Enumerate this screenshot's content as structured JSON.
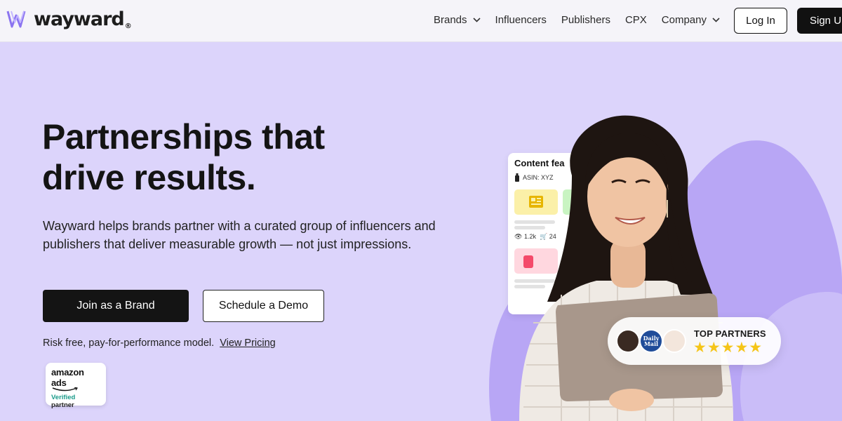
{
  "brand": {
    "name": "wayward",
    "reg": "®"
  },
  "nav": {
    "items": [
      {
        "label": "Brands",
        "dropdown": true
      },
      {
        "label": "Influencers",
        "dropdown": false
      },
      {
        "label": "Publishers",
        "dropdown": false
      },
      {
        "label": "CPX",
        "dropdown": false
      },
      {
        "label": "Company",
        "dropdown": true
      }
    ],
    "login": "Log In",
    "signup": "Sign Up"
  },
  "hero": {
    "title_line1": "Partnerships that",
    "title_line2": "drive results.",
    "subtitle": "Wayward helps brands partner with a curated group of influencers and publishers that deliver measurable growth — not just impressions.",
    "primary_cta": "Join as a Brand",
    "secondary_cta": "Schedule a Demo",
    "risk_text": "Risk free, pay-for-performance model.",
    "pricing_link": "View Pricing"
  },
  "badge": {
    "title": "amazon ads",
    "verified": "Verified",
    "partner": "partner"
  },
  "content_card": {
    "title": "Content fea",
    "asin": "ASIN: XYZ",
    "views": "1.2k",
    "carts": "24"
  },
  "partners": {
    "label": "TOP PARTNERS",
    "stars": "★★★★★",
    "avatar2_text": "Daily Mail"
  },
  "colors": {
    "hero_bg": "#dcd4fb",
    "blob": "#b8a6f5",
    "primary": "#141414",
    "star": "#f5c518"
  }
}
